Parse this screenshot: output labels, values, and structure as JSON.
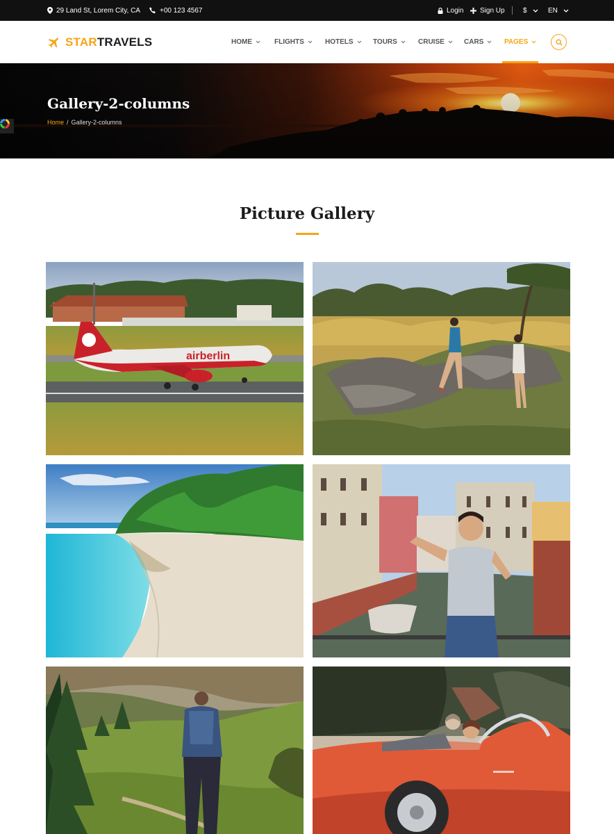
{
  "topbar": {
    "address": "29 Land St, Lorem City, CA",
    "phone": "+00 123 4567",
    "login": "Login",
    "signup": "Sign Up",
    "currency": "$",
    "language": "EN"
  },
  "header": {
    "logo_star": "STAR",
    "logo_travels": "TRAVELS",
    "nav": [
      {
        "label": "HOME"
      },
      {
        "label": "FLIGHTS"
      },
      {
        "label": "HOTELS"
      },
      {
        "label": "TOURS"
      },
      {
        "label": "CRUISE"
      },
      {
        "label": "CARS"
      },
      {
        "label": "PAGES",
        "active": true
      }
    ]
  },
  "banner": {
    "title": "Gallery-2-columns",
    "breadcrumb_home": "Home",
    "breadcrumb_sep": "/",
    "breadcrumb_current": "Gallery-2-columns"
  },
  "section": {
    "title": "Picture Gallery"
  },
  "gallery": [
    {
      "name": "airplane-photo",
      "plane_livery": "airberlin"
    },
    {
      "name": "hikers-rocks-photo"
    },
    {
      "name": "beach-photo"
    },
    {
      "name": "venice-man-photo"
    },
    {
      "name": "mountain-hiker-photo"
    },
    {
      "name": "red-convertible-photo"
    }
  ],
  "colors": {
    "accent": "#f5a416",
    "topbar_bg": "#111111",
    "heading": "#1c1c1c"
  }
}
